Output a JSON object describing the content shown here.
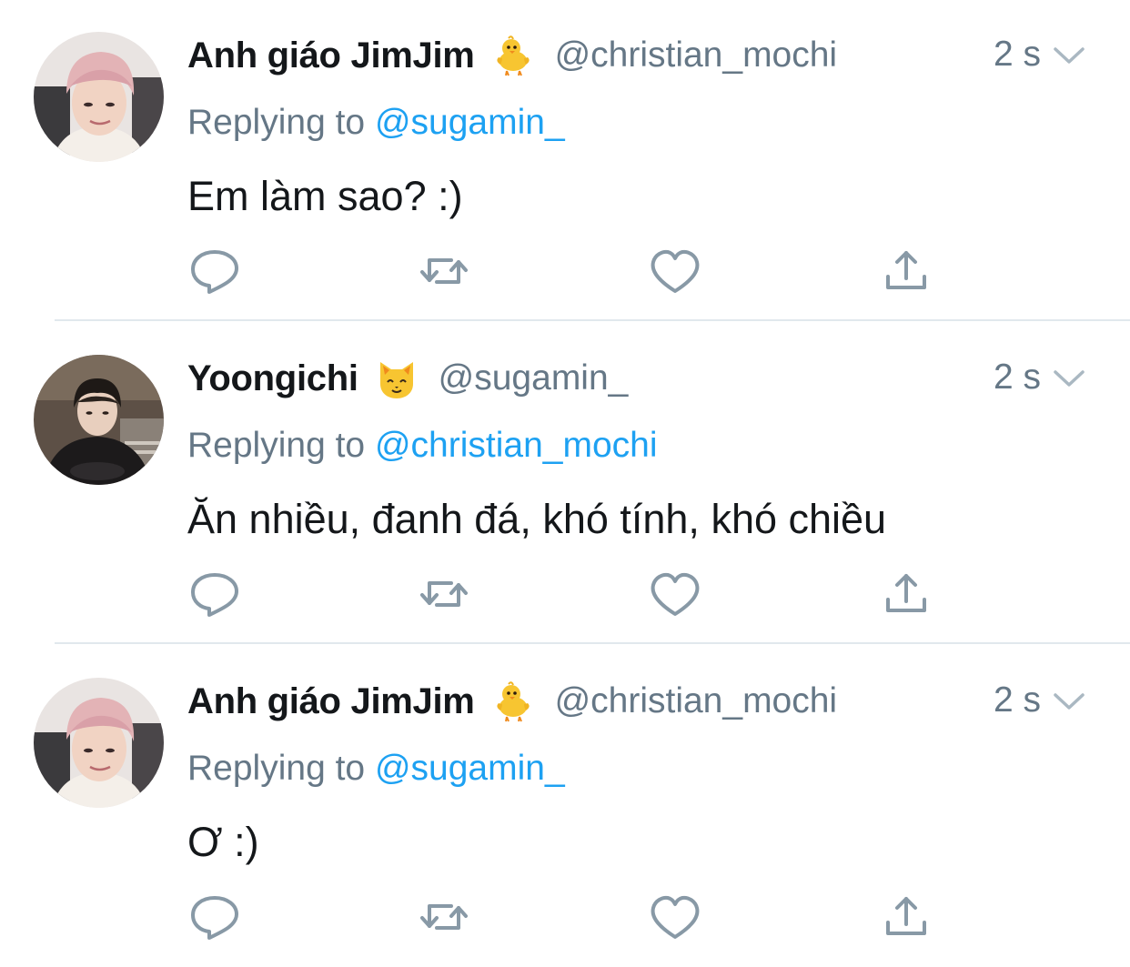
{
  "tweets": [
    {
      "name": "Anh giáo JimJim",
      "emoji": "chick-emoji",
      "handle": "@christian_mochi",
      "time": "2 s",
      "replying_prefix": "Replying to ",
      "replying_to": "@sugamin_",
      "text": "Em làm sao? :)"
    },
    {
      "name": "Yoongichi",
      "emoji": "cat-emoji",
      "handle": "@sugamin_",
      "time": "2 s",
      "replying_prefix": "Replying to ",
      "replying_to": "@christian_mochi",
      "text": "Ăn nhiều, đanh đá, khó tính, khó chiều"
    },
    {
      "name": "Anh giáo JimJim",
      "emoji": "chick-emoji",
      "handle": "@christian_mochi",
      "time": "2 s",
      "replying_prefix": "Replying to ",
      "replying_to": "@sugamin_",
      "text": "Ơ :)"
    }
  ],
  "colors": {
    "text": "#14171a",
    "secondary": "#657786",
    "link": "#1da1f2",
    "divider": "#e1e8ed",
    "icon": "#8899a6"
  },
  "icons": [
    "reply-icon",
    "retweet-icon",
    "like-icon",
    "share-icon",
    "chevron-down-icon"
  ]
}
